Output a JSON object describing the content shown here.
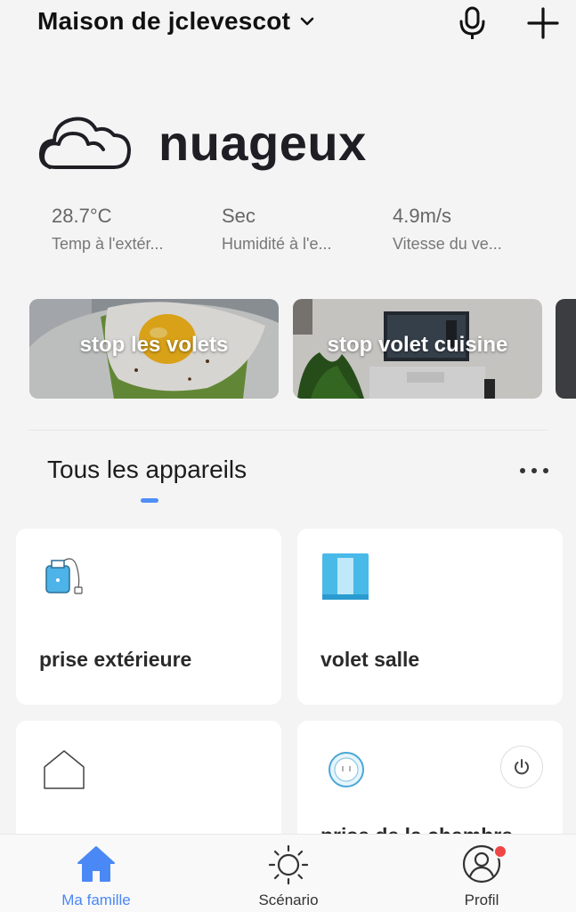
{
  "header": {
    "home_name": "Maison de jclevescot",
    "icons": [
      "chevron-down-icon",
      "microphone-icon",
      "plus-icon"
    ]
  },
  "weather": {
    "icon": "cloud-icon",
    "condition": "nuageux",
    "stats": [
      {
        "value": "28.7°C",
        "label": "Temp à l'extér..."
      },
      {
        "value": "Sec",
        "label": "Humidité à l'e..."
      },
      {
        "value": "4.9m/s",
        "label": "Vitesse du ve..."
      }
    ]
  },
  "scenes": [
    {
      "label": "stop les volets",
      "image": "egg-toast-photo"
    },
    {
      "label": "stop volet cuisine",
      "image": "living-room-tv-photo"
    }
  ],
  "devices_section": {
    "title": "Tous les appareils"
  },
  "devices": [
    {
      "name": "prise extérieure",
      "icon": "smart-plug-icon"
    },
    {
      "name": "volet salle",
      "icon": "curtain-icon"
    },
    {
      "name": "",
      "icon": "house-outline-icon"
    },
    {
      "name": "prise de la chambre",
      "icon": "round-plug-icon",
      "power_icon": "power-icon"
    }
  ],
  "bottom_nav": [
    {
      "label": "Ma famille",
      "icon": "home-icon",
      "active": true
    },
    {
      "label": "Scénario",
      "icon": "sun-icon",
      "active": false
    },
    {
      "label": "Profil",
      "icon": "profile-icon",
      "active": false,
      "notification": true
    }
  ],
  "colors": {
    "accent": "#4a88f5",
    "background": "#f4f4f5",
    "card": "#ffffff",
    "badge": "#f04545"
  }
}
